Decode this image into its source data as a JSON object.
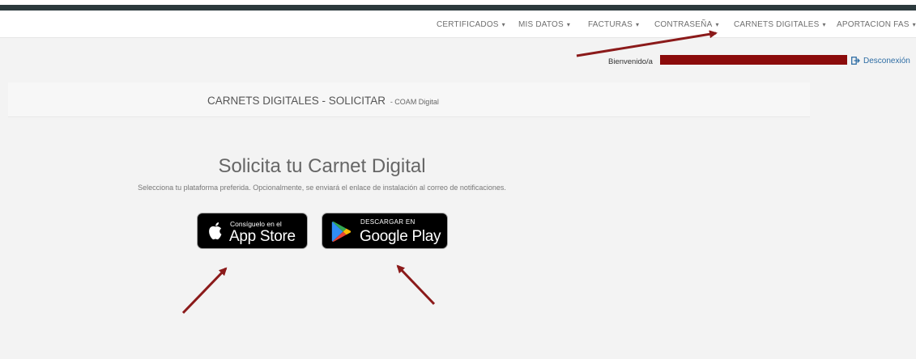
{
  "nav": {
    "items": [
      {
        "label": "CERTIFICADOS"
      },
      {
        "label": "MIS DATOS"
      },
      {
        "label": "FACTURAS"
      },
      {
        "label": "CONTRASEÑA"
      },
      {
        "label": "CARNETS DIGITALES"
      },
      {
        "label": "APORTACION FAS"
      }
    ],
    "caret": "▾"
  },
  "user": {
    "welcome": "Bienvenido/a",
    "logout": "Desconexión"
  },
  "page": {
    "title": "CARNETS DIGITALES - SOLICITAR",
    "subtitle": "- COAM Digital"
  },
  "main": {
    "heading": "Solicita tu Carnet Digital",
    "description": "Selecciona tu plataforma preferida. Opcionalmente, se enviará el enlace de instalación al correo de notificaciones."
  },
  "stores": {
    "apple": {
      "small": "Consíguelo en el",
      "big": "App Store"
    },
    "google": {
      "small": "DESCARGAR EN",
      "big": "Google Play"
    }
  },
  "colors": {
    "accent": "#2e6da4",
    "annotation_arrow": "#8b1a1a",
    "redaction": "#8b0b0b",
    "topbar": "#2c3a3d"
  }
}
